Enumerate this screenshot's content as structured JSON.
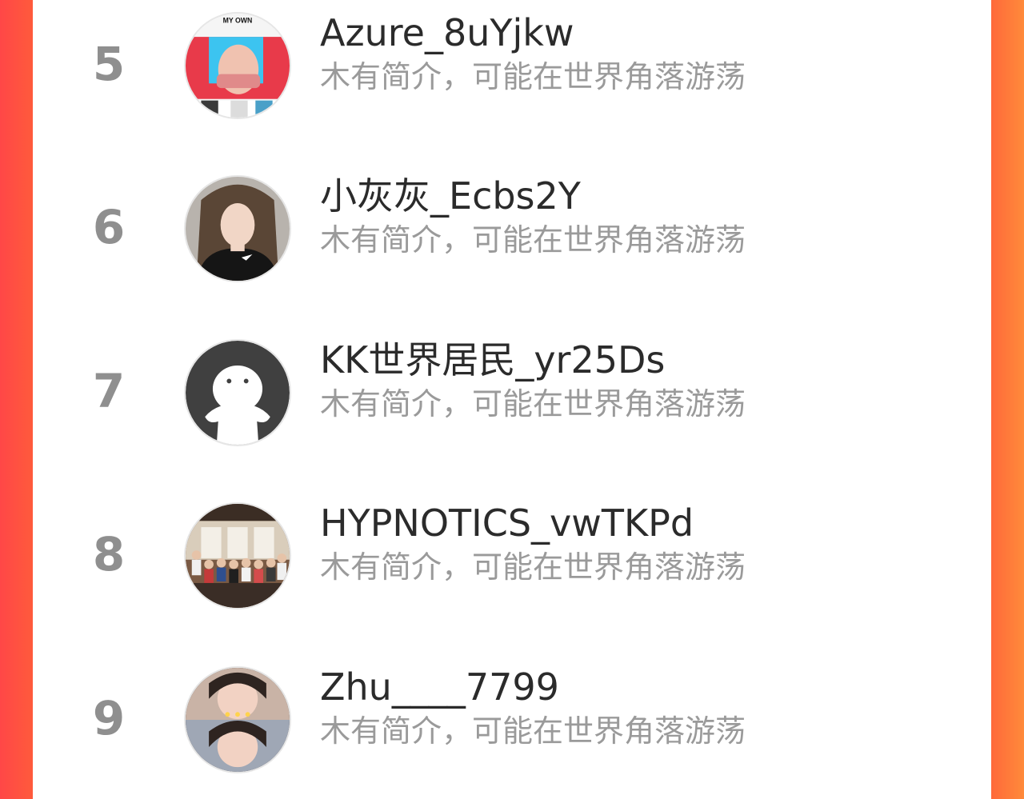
{
  "colors": {
    "panel": "#ffffff",
    "background_gradient": [
      "#ff4747",
      "#ff8a3a"
    ],
    "rank_text": "#8f8f8f",
    "name_text": "#2b2b2b",
    "bio_text": "#9a9a9a"
  },
  "rows": [
    {
      "rank": "5",
      "name": "Azure_8uYjkw",
      "bio": "木有简介，可能在世界角落游荡",
      "avatar": "user-photo-avatar",
      "avatar_text": "MY OWN"
    },
    {
      "rank": "6",
      "name": "小灰灰_Ecbs2Y",
      "bio": "木有简介，可能在世界角落游荡",
      "avatar": "user-photo-avatar"
    },
    {
      "rank": "7",
      "name": "KK世界居民_yr25Ds",
      "bio": "木有简介，可能在世界角落游荡",
      "avatar": "default-ghost-avatar"
    },
    {
      "rank": "8",
      "name": "HYPNOTICS_vwTKPd",
      "bio": "木有简介，可能在世界角落游荡",
      "avatar": "group-photo-avatar"
    },
    {
      "rank": "9",
      "name": "Zhu____7799",
      "bio": "木有简介，可能在世界角落游荡",
      "avatar": "user-photo-avatar"
    }
  ]
}
